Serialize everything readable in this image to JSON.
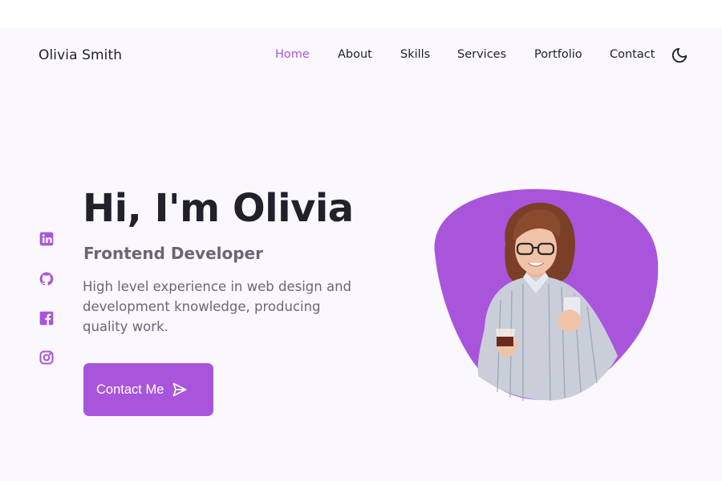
{
  "header": {
    "logo": "Olivia Smith",
    "nav": [
      {
        "label": "Home",
        "active": true
      },
      {
        "label": "About",
        "active": false
      },
      {
        "label": "Skills",
        "active": false
      },
      {
        "label": "Services",
        "active": false
      },
      {
        "label": "Portfolio",
        "active": false
      },
      {
        "label": "Contact",
        "active": false
      }
    ],
    "theme_icon": "moon-icon"
  },
  "socials": [
    "linkedin-icon",
    "github-icon",
    "facebook-icon",
    "instagram-icon"
  ],
  "hero": {
    "title": "Hi, I'm Olivia",
    "subtitle": "Frontend Developer",
    "description": "High level experience in web design and development knowledge, producing quality work.",
    "cta_label": "Contact Me",
    "cta_icon": "send-icon"
  },
  "colors": {
    "accent": "#a855db",
    "text_dark": "#22212b",
    "text_muted": "#6b6578",
    "background": "#fbf8fd"
  }
}
